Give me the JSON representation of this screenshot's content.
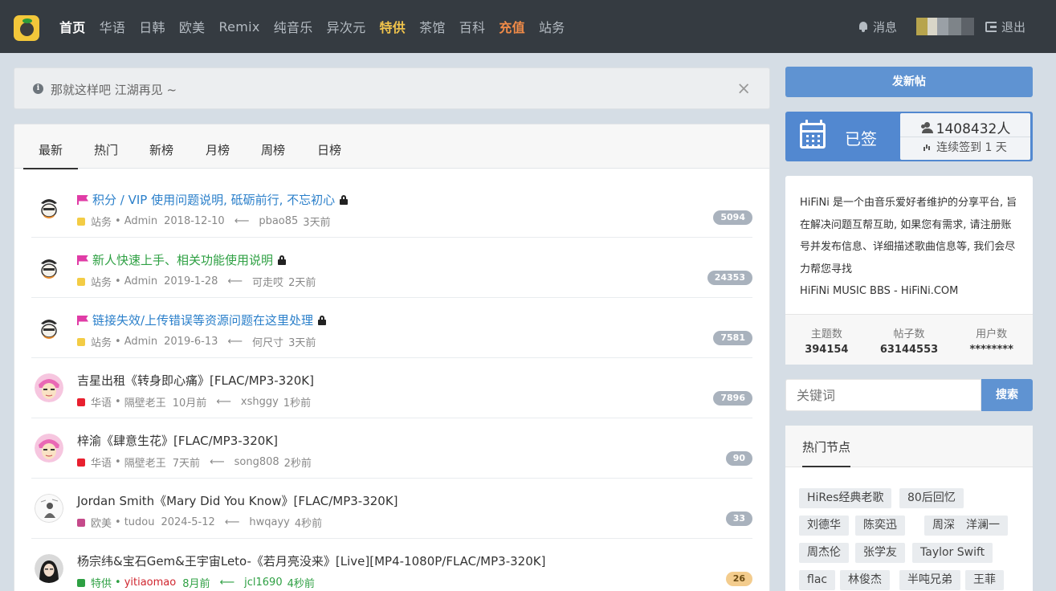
{
  "nav": {
    "items": [
      {
        "label": "首页",
        "style": "active"
      },
      {
        "label": "华语",
        "style": ""
      },
      {
        "label": "日韩",
        "style": ""
      },
      {
        "label": "欧美",
        "style": ""
      },
      {
        "label": "Remix",
        "style": ""
      },
      {
        "label": "纯音乐",
        "style": ""
      },
      {
        "label": "异次元",
        "style": ""
      },
      {
        "label": "特供",
        "style": "special"
      },
      {
        "label": "茶馆",
        "style": ""
      },
      {
        "label": "百科",
        "style": ""
      },
      {
        "label": "充值",
        "style": "recharge"
      },
      {
        "label": "站务",
        "style": ""
      }
    ],
    "messages_label": "消息",
    "logout_label": "退出"
  },
  "notice": {
    "text": "那就这样吧 江湖再见 ~",
    "close_label": "×"
  },
  "tabs": [
    "最新",
    "热门",
    "新榜",
    "月榜",
    "周榜",
    "日榜"
  ],
  "threads": [
    {
      "title": "积分 / VIP 使用问题说明, 砥砺前行, 不忘初心",
      "pinned": true,
      "locked": true,
      "title_color": "#2a7fca",
      "category": "站务",
      "category_color": "#f3cc45",
      "author": "Admin",
      "author_color": "#888",
      "date": "2018-12-10",
      "last_user": "pbao85",
      "last_time": "3天前",
      "replies": "5094",
      "hot": false,
      "avatar": "admin"
    },
    {
      "title": "新人快速上手、相关功能使用说明",
      "pinned": true,
      "locked": true,
      "title_color": "#2ea043",
      "category": "站务",
      "category_color": "#f3cc45",
      "author": "Admin",
      "author_color": "#888",
      "date": "2019-1-28",
      "last_user": "可走哎",
      "last_time": "2天前",
      "replies": "24353",
      "hot": false,
      "avatar": "admin"
    },
    {
      "title": "链接失效/上传错误等资源问题在这里处理",
      "pinned": true,
      "locked": true,
      "title_color": "#2a7fca",
      "category": "站务",
      "category_color": "#f3cc45",
      "author": "Admin",
      "author_color": "#888",
      "date": "2019-6-13",
      "last_user": "何尺寸",
      "last_time": "3天前",
      "replies": "7581",
      "hot": false,
      "avatar": "admin"
    },
    {
      "title": "吉星出租《转身即心痛》[FLAC/MP3-320K]",
      "pinned": false,
      "locked": false,
      "title_color": "#333",
      "category": "华语",
      "category_color": "#e8202f",
      "author": "隔壁老王",
      "author_color": "#888",
      "date": "10月前",
      "last_user": "xshggy",
      "last_time": "1秒前",
      "replies": "7896",
      "hot": false,
      "avatar": "pink"
    },
    {
      "title": "梓渝《肆意生花》[FLAC/MP3-320K]",
      "pinned": false,
      "locked": false,
      "title_color": "#333",
      "category": "华语",
      "category_color": "#e8202f",
      "author": "隔壁老王",
      "author_color": "#888",
      "date": "7天前",
      "last_user": "song808",
      "last_time": "2秒前",
      "replies": "90",
      "hot": false,
      "avatar": "pink"
    },
    {
      "title": "Jordan Smith《Mary Did You Know》[FLAC/MP3-320K]",
      "pinned": false,
      "locked": false,
      "title_color": "#333",
      "category": "欧美",
      "category_color": "#c54a8a",
      "author": "tudou",
      "author_color": "#888",
      "date": "2024-5-12",
      "last_user": "hwqayy",
      "last_time": "4秒前",
      "replies": "33",
      "hot": false,
      "avatar": "sketch"
    },
    {
      "title": "杨宗纬&宝石Gem&王宇宙Leto-《若月亮没来》[Live][MP4-1080P/FLAC/MP3-320K]",
      "pinned": false,
      "locked": false,
      "title_color": "#333",
      "category": "特供",
      "category_color": "#2ea043",
      "author": "yitiaomao",
      "author_color": "#d0262f",
      "date": "8月前",
      "last_user": "jcl1690",
      "last_time": "4秒前",
      "replies": "26",
      "hot": true,
      "avatar": "photo",
      "meta_color": "#2ea043"
    }
  ],
  "sidebar": {
    "post_button": "发新帖",
    "signed_label": "已签",
    "sign_count": "1408432人",
    "sign_streak": "连续签到 1 天",
    "about_text": "HiFiNi 是一个由音乐爱好者维护的分享平台, 旨在解决问题互帮互助, 如果您有需求, 请注册账号并发布信息、详细描述歌曲信息等, 我们会尽力帮您寻找",
    "about_footer": "HiFiNi MUSIC BBS - HiFiNi.COM",
    "stats": [
      {
        "label": "主题数",
        "value": "394154"
      },
      {
        "label": "帖子数",
        "value": "63144553"
      },
      {
        "label": "用户数",
        "value": "********"
      }
    ],
    "search_placeholder": "关键词",
    "search_button": "搜索",
    "hot_title": "热门节点",
    "hot_tags": [
      "HiRes经典老歌",
      "80后回忆",
      "刘德华",
      "陈奕迅",
      "周深",
      "洋澜一",
      "周杰伦",
      "张学友",
      "Taylor Swift",
      "flac",
      "林俊杰",
      "半吨兄弟",
      "王菲"
    ]
  }
}
